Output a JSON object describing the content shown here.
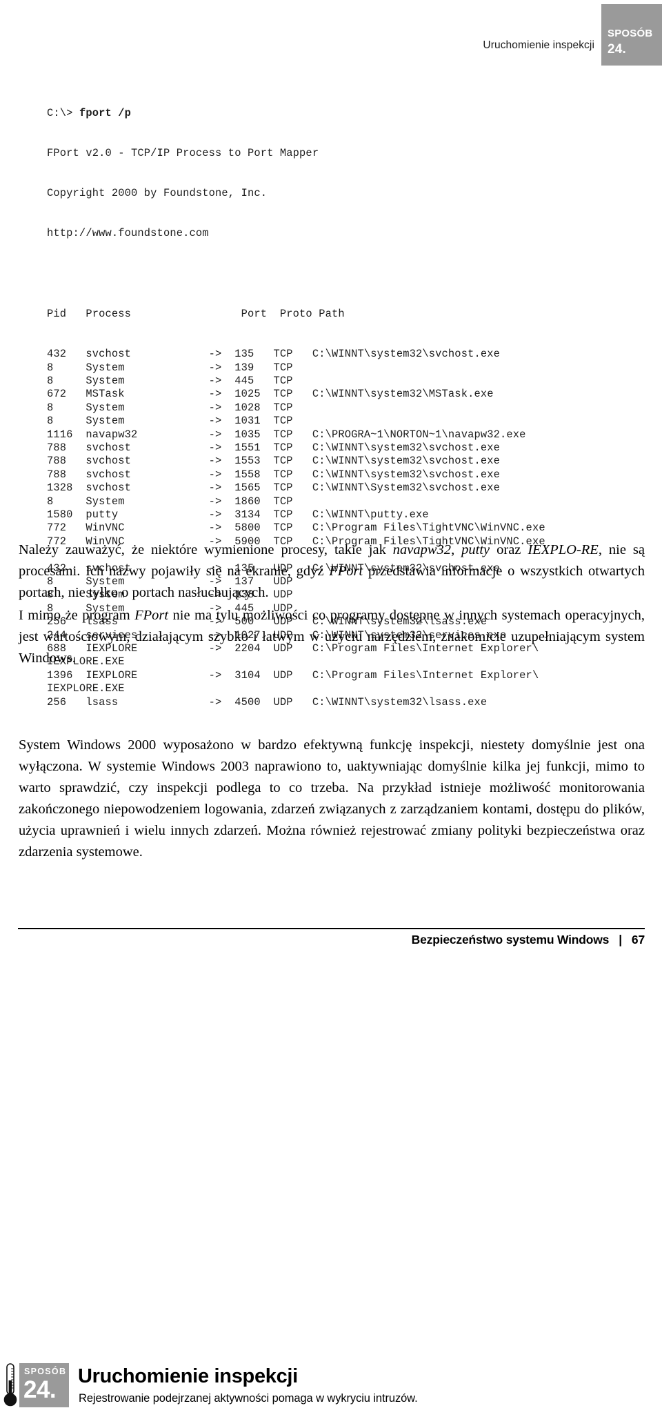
{
  "running_head": {
    "title": "Uruchomienie inspekcji",
    "badge_label": "SPOSÓB",
    "badge_number": "24.",
    "badge_color": "#9a9a9a"
  },
  "code_block": {
    "prompt": "C:\\> ",
    "command": "fport /p",
    "banner": [
      "FPort v2.0 - TCP/IP Process to Port Mapper",
      "Copyright 2000 by Foundstone, Inc.",
      "http://www.foundstone.com"
    ],
    "columns": [
      "Pid",
      "Process",
      "Port",
      "Proto",
      "Path"
    ],
    "header_line": "Pid   Process                 Port  Proto Path",
    "rows": [
      "432   svchost            ->  135   TCP   C:\\WINNT\\system32\\svchost.exe",
      "8     System             ->  139   TCP",
      "8     System             ->  445   TCP",
      "672   MSTask             ->  1025  TCP   C:\\WINNT\\system32\\MSTask.exe",
      "8     System             ->  1028  TCP",
      "8     System             ->  1031  TCP",
      "1116  navapw32           ->  1035  TCP   C:\\PROGRA~1\\NORTON~1\\navapw32.exe",
      "788   svchost            ->  1551  TCP   C:\\WINNT\\system32\\svchost.exe",
      "788   svchost            ->  1553  TCP   C:\\WINNT\\system32\\svchost.exe",
      "788   svchost            ->  1558  TCP   C:\\WINNT\\system32\\svchost.exe",
      "1328  svchost            ->  1565  TCP   C:\\WINNT\\System32\\svchost.exe",
      "8     System             ->  1860  TCP",
      "1580  putty              ->  3134  TCP   C:\\WINNT\\putty.exe",
      "772   WinVNC             ->  5800  TCP   C:\\Program Files\\TightVNC\\WinVNC.exe",
      "772   WinVNC             ->  5900  TCP   C:\\Program Files\\TightVNC\\WinVNC.exe",
      "",
      "432   svchost            ->  135   UDP   C:\\WINNT\\system32\\svchost.exe",
      "8     System             ->  137   UDP",
      "8     System             ->  138   UDP",
      "8     System             ->  445   UDP",
      "256   lsass              ->  500   UDP   C:\\WINNT\\system32\\lsass.exe",
      "244   services           ->  1027  UDP   C:\\WINNT\\system32\\services.exe",
      "688   IEXPLORE           ->  2204  UDP   C:\\Program Files\\Internet Explorer\\",
      "IEXPLORE.EXE",
      "1396  IEXPLORE           ->  3104  UDP   C:\\Program Files\\Internet Explorer\\",
      "IEXPLORE.EXE",
      "256   lsass              ->  4500  UDP   C:\\WINNT\\system32\\lsass.exe"
    ]
  },
  "paragraphs": {
    "p1_html": "Należy zauważyć, że niektóre wymienione procesy, takie jak <i>navapw32</i>, <i>putty</i> oraz <i>IEXPLO-RE</i>, nie są procesami. Ich nazwy pojawiły się na ekranie, gdyż <i>FPort</i> przedstawia informacje o wszystkich otwartych portach, nie tylko o portach nasłuchujących.",
    "p2_html": "I mimo że program <i>FPort</i> nie ma tylu możliwości co programy dostępne w innych systemach operacyjnych, jest wartościowym, działającym szybko i łatwym w użyciu narzędziem, znakomicie uzupełniającym system Windows.",
    "p3_html": "System Windows 2000 wyposażono w bardzo efektywną funkcję inspekcji, niestety domyślnie jest ona wyłączona. W systemie Windows 2003 naprawiono to, uaktywniając domyślnie kilka jej funkcji, mimo to warto sprawdzić, czy inspekcji podlega to co trzeba. Na przykład istnieje możliwość monitorowania zakończonego niepowodzeniem logowania, zdarzeń związanych z zarządzaniem kontami, dostępu do plików, użycia uprawnień i wielu innych zdarzeń. Można również rejestrować zmiany polityki bezpieczeństwa oraz zdarzenia systemowe."
  },
  "section": {
    "badge_label": "SPOSÓB",
    "badge_number": "24.",
    "badge_color": "#9a9a9a",
    "title": "Uruchomienie inspekcji",
    "subtitle": "Rejestrowanie podejrzanej aktywności pomaga w wykryciu intruzów."
  },
  "footer": {
    "text": "Bezpieczeństwo systemu Windows",
    "separator": "|",
    "page_number": "67"
  }
}
